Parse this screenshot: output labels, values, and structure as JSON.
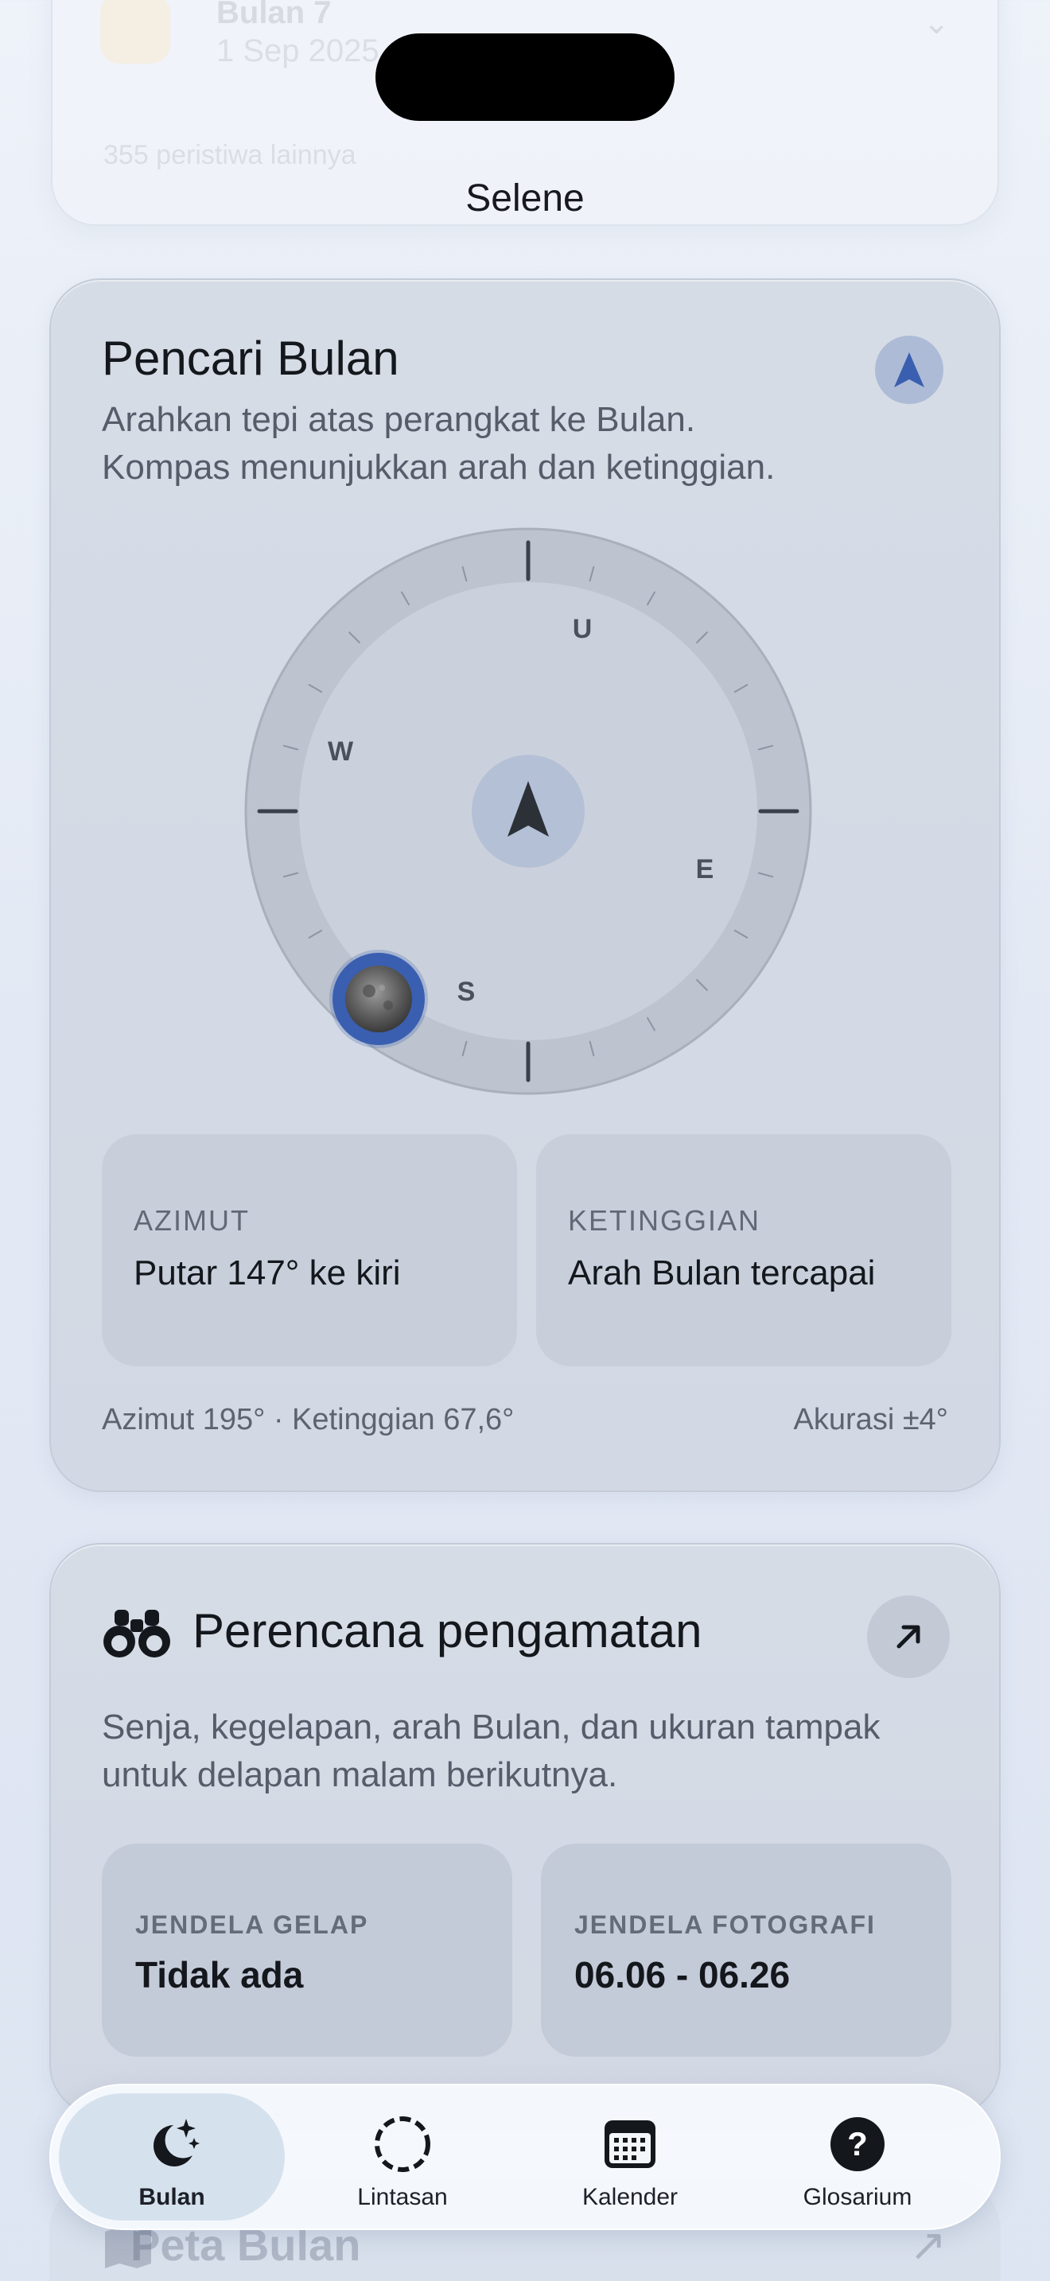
{
  "app": {
    "title": "Selene"
  },
  "previous_card": {
    "title": "Bulan 7",
    "date": "1 Sep 2025",
    "more": "355 peristiwa lainnya"
  },
  "moon_finder": {
    "title": "Pencari Bulan",
    "description_line1": "Arahkan tepi atas perangkat ke Bulan.",
    "description_line2": "Kompas menunjukkan arah dan ketinggian.",
    "compass": {
      "north": "U",
      "east": "E",
      "south": "S",
      "west": "W",
      "moon_azimuth_deg": 195,
      "device_heading_deg": 48
    },
    "azimuth_label": "AZIMUT",
    "azimuth_value": "Putar 147° ke kiri",
    "altitude_label": "KETINGGIAN",
    "altitude_value": "Arah Bulan tercapai",
    "footer_left": "Azimut 195° · Ketinggian 67,6°",
    "footer_right": "Akurasi ±4°",
    "accent": "#3a5fb0"
  },
  "planner": {
    "title": "Perencana pengamatan",
    "description_line1": "Senja, kegelapan, arah Bulan, dan ukuran tampak",
    "description_line2": "untuk delapan malam berikutnya.",
    "dark_window_label": "JENDELA GELAP",
    "dark_window_value": "Tidak ada",
    "photo_window_label": "JENDELA FOTOGRAFI",
    "photo_window_value": "06.06 - 06.26"
  },
  "next_card": {
    "title": "Peta Bulan"
  },
  "tabbar": {
    "tabs": [
      {
        "label": "Bulan",
        "icon": "moon-stars-icon",
        "active": true
      },
      {
        "label": "Lintasan",
        "icon": "dashed-circle-icon",
        "active": false
      },
      {
        "label": "Kalender",
        "icon": "calendar-icon",
        "active": false
      },
      {
        "label": "Glosarium",
        "icon": "question-circle-icon",
        "active": false
      }
    ]
  }
}
